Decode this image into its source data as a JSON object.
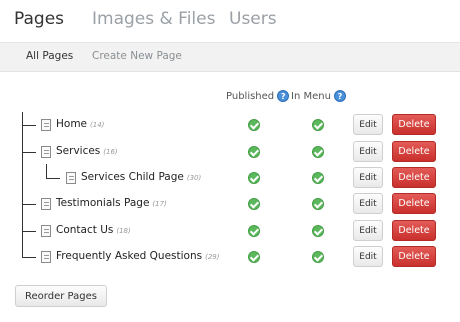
{
  "topnav": {
    "tabs": [
      {
        "label": "Pages",
        "active": true
      },
      {
        "label": "Images & Files",
        "active": false
      },
      {
        "label": "Users",
        "active": false
      }
    ]
  },
  "subnav": {
    "tabs": [
      {
        "label": "All Pages",
        "active": true
      },
      {
        "label": "Create New Page",
        "active": false
      }
    ]
  },
  "columns": {
    "published": "Published",
    "in_menu": "In Menu",
    "help_glyph": "?"
  },
  "pages": [
    {
      "title": "Home",
      "count": "(14)",
      "level": 0,
      "published": true,
      "in_menu": true
    },
    {
      "title": "Services",
      "count": "(16)",
      "level": 0,
      "published": true,
      "in_menu": true
    },
    {
      "title": "Services Child Page",
      "count": "(30)",
      "level": 1,
      "published": true,
      "in_menu": true
    },
    {
      "title": "Testimonials Page",
      "count": "(17)",
      "level": 0,
      "published": true,
      "in_menu": true
    },
    {
      "title": "Contact Us",
      "count": "(18)",
      "level": 0,
      "published": true,
      "in_menu": true
    },
    {
      "title": "Frequently Asked Questions",
      "count": "(29)",
      "level": 0,
      "published": true,
      "in_menu": true
    }
  ],
  "actions": {
    "edit_label": "Edit",
    "delete_label": "Delete",
    "reorder_label": "Reorder Pages"
  },
  "colors": {
    "delete": "#d9534f",
    "check": "#5cb85c",
    "help": "#4a90d9"
  }
}
